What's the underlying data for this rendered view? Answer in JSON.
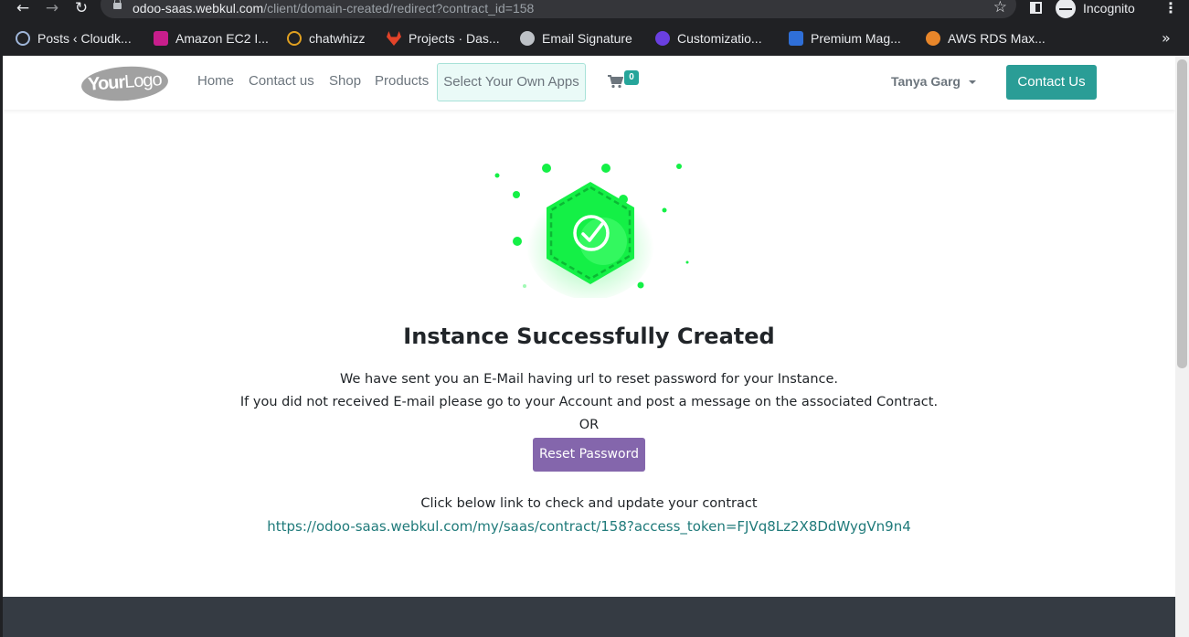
{
  "browser": {
    "url_host": "odoo-saas.webkul.com",
    "url_path": "/client/domain-created/redirect?contract_id=158",
    "incognito_label": "Incognito",
    "bookmarks": [
      {
        "label": "Posts ‹ Cloudk...",
        "icon": "wordpress-icon",
        "color": "#9fb6d9"
      },
      {
        "label": "Amazon EC2 I...",
        "icon": "amazon-ec2-icon",
        "color": "#c81e8c"
      },
      {
        "label": "chatwhizz",
        "icon": "chatwhizz-icon",
        "color": "#e0a020"
      },
      {
        "label": "Projects · Das...",
        "icon": "gitlab-icon",
        "color": "#e24329"
      },
      {
        "label": "Email Signature",
        "icon": "globe-icon",
        "color": "#bdc1c6"
      },
      {
        "label": "Customizatio...",
        "icon": "customization-icon",
        "color": "#6a3fe0"
      },
      {
        "label": "Premium Mag...",
        "icon": "magento-icon",
        "color": "#2f6fd8"
      },
      {
        "label": "AWS RDS Max...",
        "icon": "aws-icon",
        "color": "#e8862a"
      }
    ]
  },
  "header": {
    "logo": {
      "bold": "Your",
      "rest": "Logo"
    },
    "nav": [
      "Home",
      "Contact us",
      "Shop",
      "Products"
    ],
    "apps_button": "Select Your Own Apps",
    "cart_count": "0",
    "user_name": "Tanya Garg",
    "contact_button": "Contact Us"
  },
  "main": {
    "title": "Instance Successfully Created",
    "line1": "We have sent you an E-Mail having url to reset password for your Instance.",
    "line2": "If you did not received E-mail please go to your Account and post a message on the associated Contract.",
    "or": "OR",
    "reset_button": "Reset Password",
    "check_text": "Click below link to check and update your contract",
    "contract_link": "https://odoo-saas.webkul.com/my/saas/contract/158?access_token=FJVq8Lz2X8DdWygVn9n4",
    "accent_color": "#14f046"
  }
}
